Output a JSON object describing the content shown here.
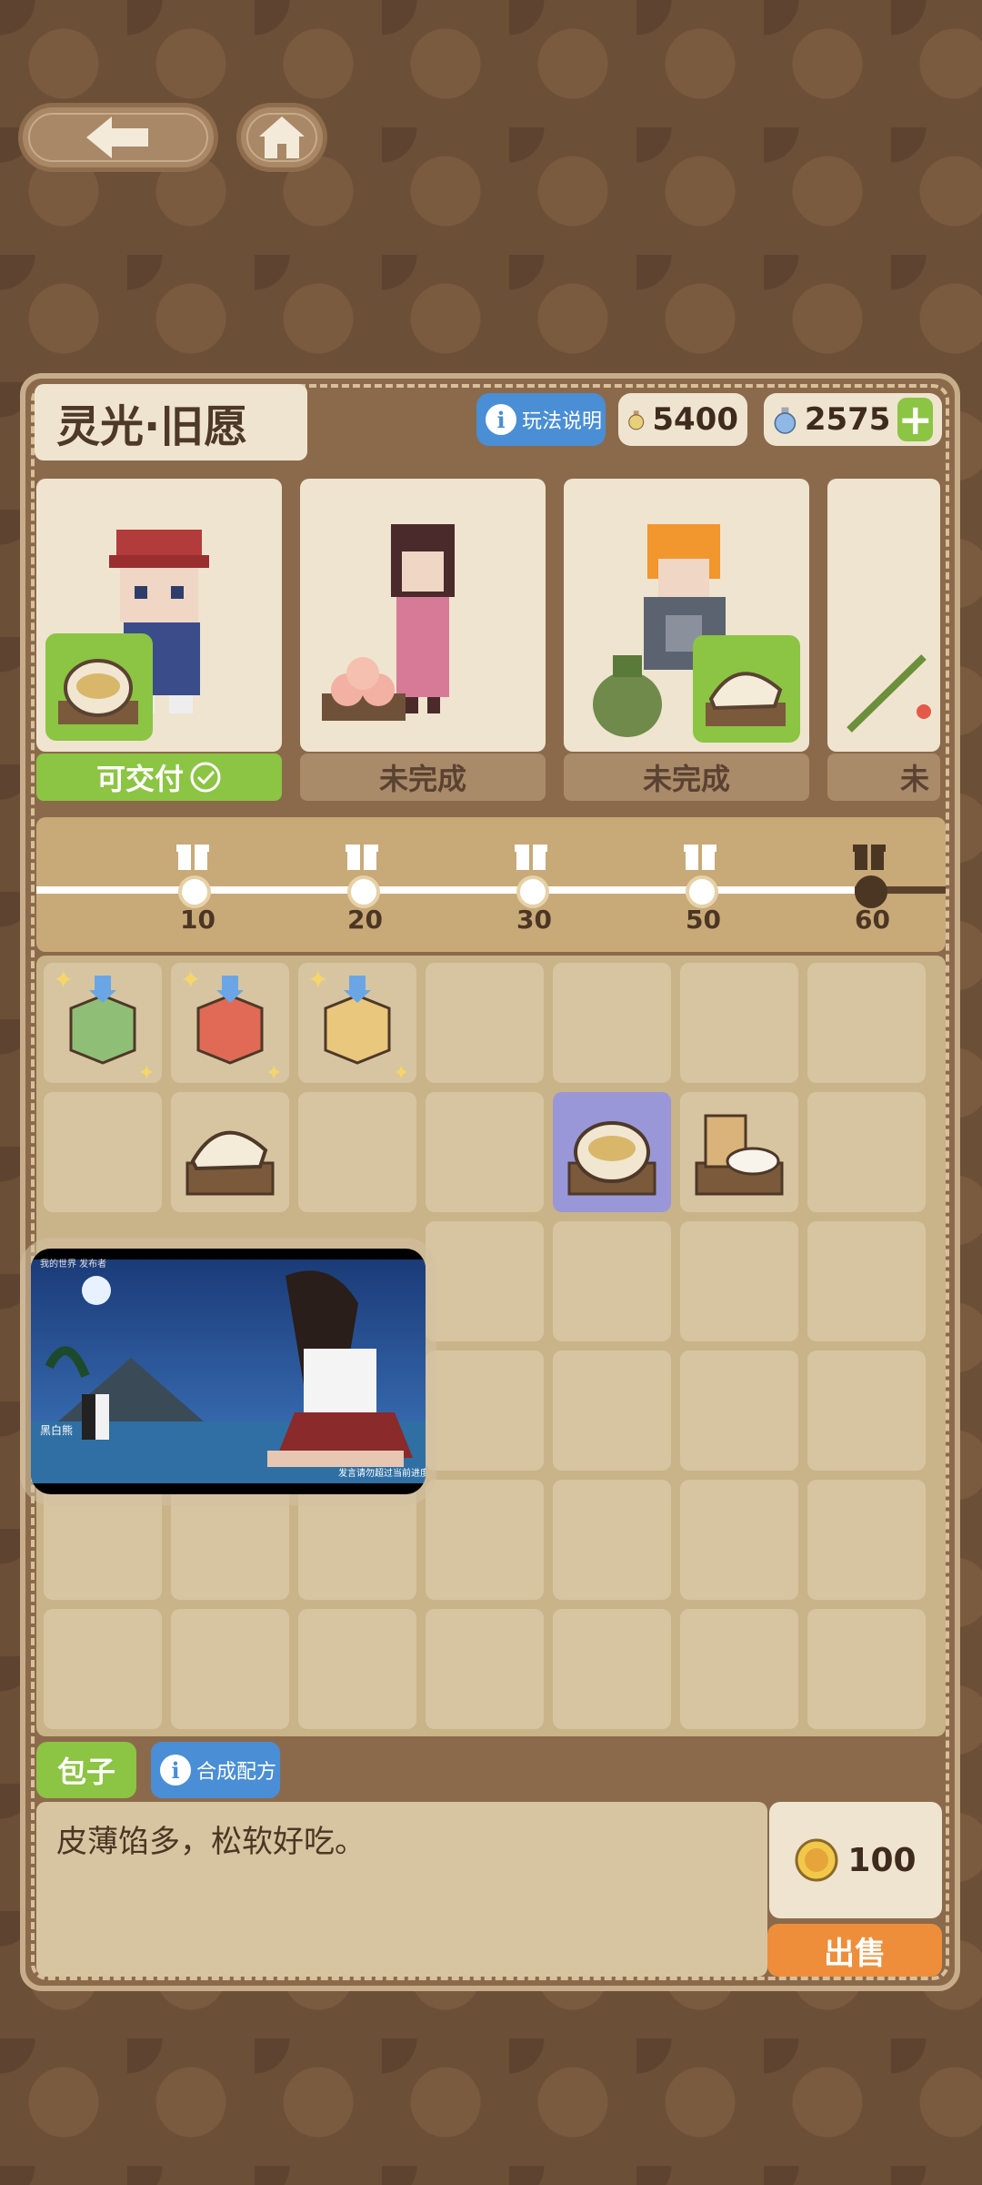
{
  "header": {
    "title": "灵光·旧愿",
    "help_label": "玩法说明",
    "gold": "5400",
    "gems": "2575"
  },
  "orders": [
    {
      "status": "可交付",
      "state": "deliverable"
    },
    {
      "status": "未完成",
      "state": "incomplete"
    },
    {
      "status": "未完成",
      "state": "incomplete"
    },
    {
      "status": "未",
      "state": "incomplete"
    }
  ],
  "milestones": [
    "10",
    "20",
    "30",
    "50",
    "60"
  ],
  "selected_item": {
    "name": "包子",
    "recipe_label": "合成配方",
    "description": "皮薄馅多，松软好吃。",
    "price": "100",
    "sell_label": "出售"
  },
  "overlay": {
    "top_text": "我的世界 发布者",
    "speaker": "黑白熊",
    "caption": "发言请勿超过当前进度"
  },
  "colors": {
    "deliverable": "#8cc443",
    "help": "#4a8ed6",
    "sell": "#ee8e3a"
  }
}
